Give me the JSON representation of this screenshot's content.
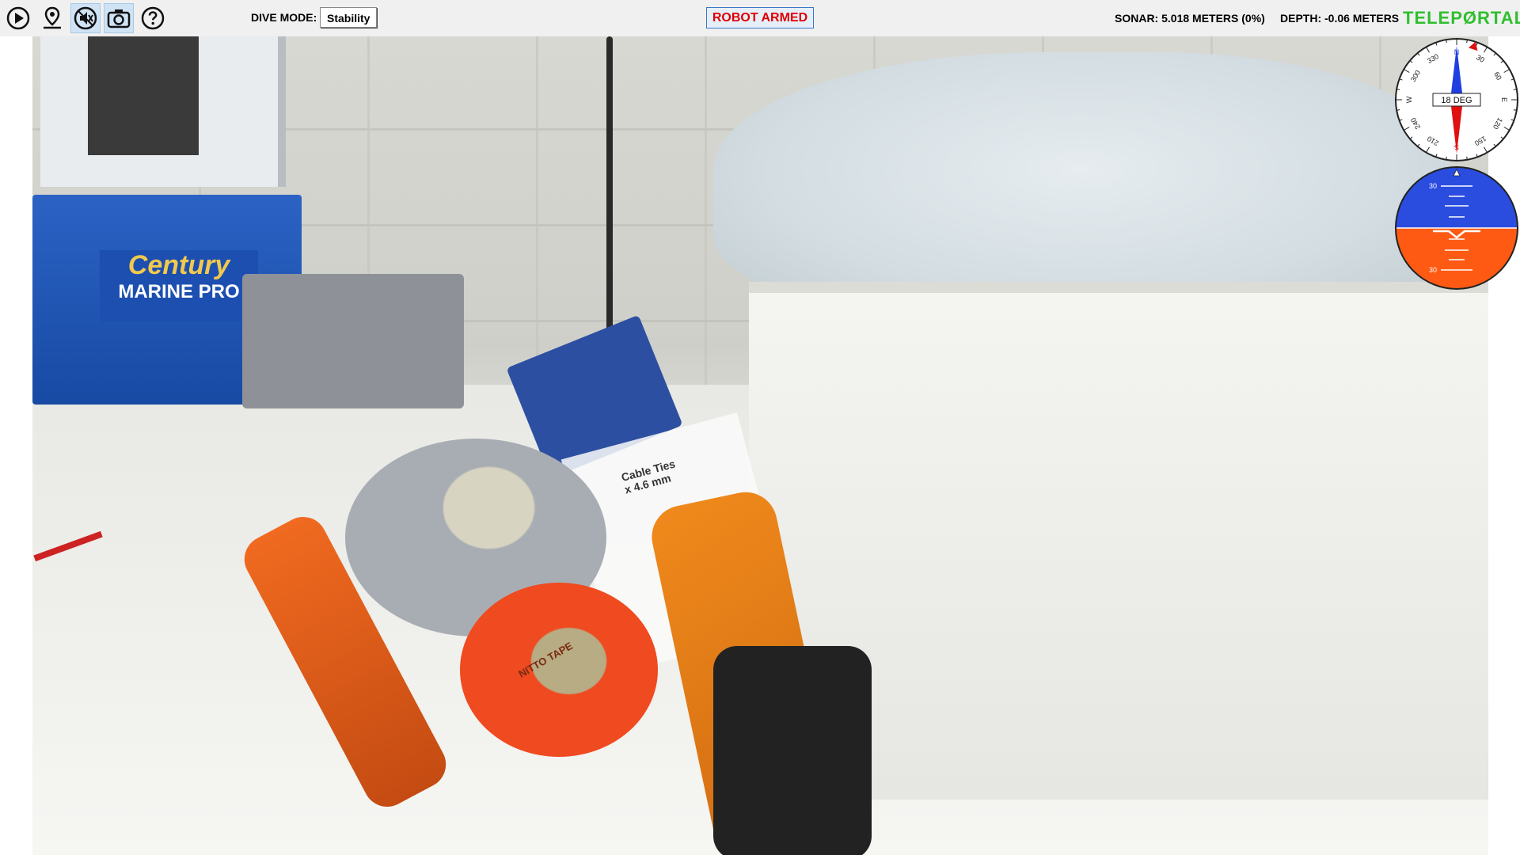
{
  "toolbar": {
    "icons": [
      "play-icon",
      "map-pin-icon",
      "speaker-muted-icon",
      "camera-icon",
      "help-icon"
    ],
    "dive_mode_label": "DIVE MODE:",
    "dive_mode_value": "Stability",
    "armed_status": "ROBOT ARMED",
    "sonar": "SONAR: 5.018 METERS (0%)",
    "depth": "DEPTH: -0.06 METERS",
    "brand": "TELEPØRTAL"
  },
  "camera_feed": {
    "visible_text": [
      "Century",
      "MARINE PRO",
      "Cable Ties",
      "x 4.6 mm",
      "NITTO TAPE"
    ]
  },
  "compass": {
    "heading_deg": 18,
    "heading_text": "18 DEG",
    "cardinals": [
      "N",
      "E",
      "S",
      "W"
    ],
    "ticks": [
      "30",
      "60",
      "120",
      "150",
      "210",
      "240",
      "300",
      "330"
    ]
  },
  "attitude": {
    "pitch_labels": [
      "30",
      "30"
    ],
    "colors": {
      "sky": "#2a4de0",
      "ground": "#ff5a14"
    }
  },
  "colors": {
    "armed_text": "#e00000",
    "brand": "#2fbf2f",
    "toolbar_bg": "#f0f0f0"
  }
}
